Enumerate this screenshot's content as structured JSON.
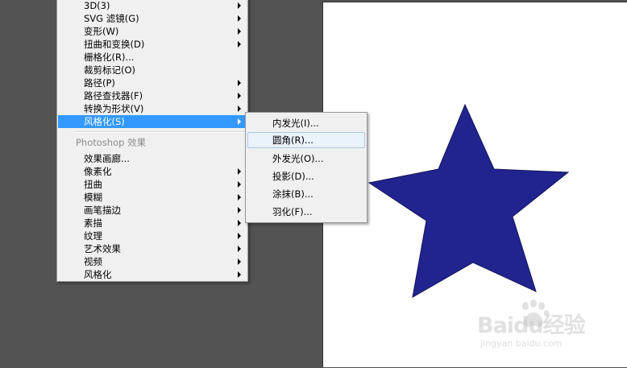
{
  "main_menu": {
    "items": [
      {
        "label": "3D(3)",
        "submenu": true
      },
      {
        "label": "SVG 滤镜(G)",
        "submenu": true
      },
      {
        "label": "变形(W)",
        "submenu": true
      },
      {
        "label": "扭曲和变换(D)",
        "submenu": true
      },
      {
        "label": "栅格化(R)...",
        "submenu": false
      },
      {
        "label": "裁剪标记(O)",
        "submenu": false
      },
      {
        "label": "路径(P)",
        "submenu": true
      },
      {
        "label": "路径查找器(F)",
        "submenu": true
      },
      {
        "label": "转换为形状(V)",
        "submenu": true
      },
      {
        "label": "风格化(S)",
        "submenu": true,
        "highlighted": true
      }
    ],
    "section_header": "Photoshop 效果",
    "photoshop_items": [
      {
        "label": "效果画廊...",
        "submenu": false
      },
      {
        "label": "像素化",
        "submenu": true
      },
      {
        "label": "扭曲",
        "submenu": true
      },
      {
        "label": "模糊",
        "submenu": true
      },
      {
        "label": "画笔描边",
        "submenu": true
      },
      {
        "label": "素描",
        "submenu": true
      },
      {
        "label": "纹理",
        "submenu": true
      },
      {
        "label": "艺术效果",
        "submenu": true
      },
      {
        "label": "视频",
        "submenu": true
      },
      {
        "label": "风格化",
        "submenu": true
      }
    ]
  },
  "submenu": {
    "items": [
      {
        "label": "内发光(I)..."
      },
      {
        "label": "圆角(R)...",
        "hovered": true
      },
      {
        "label": "外发光(O)..."
      },
      {
        "label": "投影(D)..."
      },
      {
        "label": "涂抹(B)..."
      },
      {
        "label": "羽化(F)..."
      }
    ]
  },
  "artboard": {
    "shape": "star",
    "fill_color": "#21248e",
    "stroke_color": "#15165c"
  },
  "watermark": {
    "logo_text": "Baidu经验",
    "url": "jingyan.baidu.com"
  },
  "colors": {
    "workspace_bg": "#535353",
    "menu_bg": "#f0f0f0",
    "highlight": "#3399ff",
    "hover_bg": "#eaf2fb",
    "hover_border": "#a9c8ea"
  }
}
